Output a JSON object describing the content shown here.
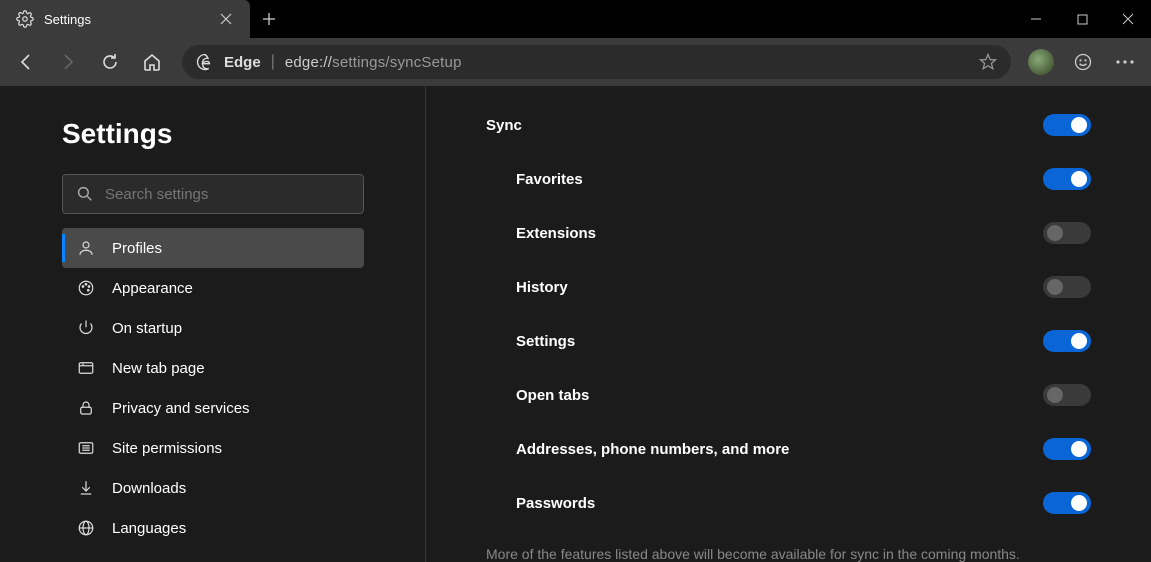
{
  "tab": {
    "title": "Settings"
  },
  "omnibox": {
    "brand": "Edge",
    "protocol": "edge://",
    "path": "settings/syncSetup"
  },
  "sidebar": {
    "title": "Settings",
    "search_placeholder": "Search settings",
    "items": [
      {
        "id": "profiles",
        "label": "Profiles",
        "icon": "person",
        "active": true
      },
      {
        "id": "appearance",
        "label": "Appearance",
        "icon": "palette"
      },
      {
        "id": "startup",
        "label": "On startup",
        "icon": "power"
      },
      {
        "id": "newtab",
        "label": "New tab page",
        "icon": "newtab"
      },
      {
        "id": "privacy",
        "label": "Privacy and services",
        "icon": "lock"
      },
      {
        "id": "permissions",
        "label": "Site permissions",
        "icon": "sliders"
      },
      {
        "id": "downloads",
        "label": "Downloads",
        "icon": "download"
      },
      {
        "id": "languages",
        "label": "Languages",
        "icon": "globe"
      }
    ]
  },
  "sync": {
    "heading": "Sync",
    "main_toggle": true,
    "items": [
      {
        "label": "Favorites",
        "state": "on"
      },
      {
        "label": "Extensions",
        "state": "disabled"
      },
      {
        "label": "History",
        "state": "disabled"
      },
      {
        "label": "Settings",
        "state": "on"
      },
      {
        "label": "Open tabs",
        "state": "disabled"
      },
      {
        "label": "Addresses, phone numbers, and more",
        "state": "on"
      },
      {
        "label": "Passwords",
        "state": "on"
      }
    ],
    "footnote": "More of the features listed above will become available for sync in the coming months."
  }
}
